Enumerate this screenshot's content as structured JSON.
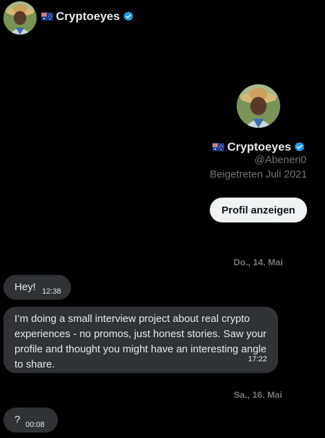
{
  "header": {
    "name": "Cryptoeyes",
    "flag_icon": "australia-flag-icon",
    "verified_icon": "verified-badge-icon",
    "verified_color": "#1d9bf0"
  },
  "profile": {
    "name": "Cryptoeyes",
    "handle": "@Abeneri0",
    "joined": "Beigetreten Juli 2021",
    "button_label": "Profil anzeigen"
  },
  "conversation": {
    "groups": [
      {
        "date": "Do., 14. Mai",
        "messages": [
          {
            "text": "Hey!",
            "time": "12:38"
          },
          {
            "text": "I’m doing a small interview project about real crypto experiences - no promos, just honest stories. Saw your profile and thought you might have an interesting angle to share.",
            "time": "17:22"
          }
        ]
      },
      {
        "date": "Sa., 16. Mai",
        "messages": [
          {
            "text": "?",
            "time": "00:08"
          }
        ]
      }
    ]
  },
  "colors": {
    "background": "#000000",
    "bubble": "#2f3336",
    "text_primary": "#e7e9ea",
    "text_secondary": "#71767b",
    "button_bg": "#eff3f4"
  }
}
